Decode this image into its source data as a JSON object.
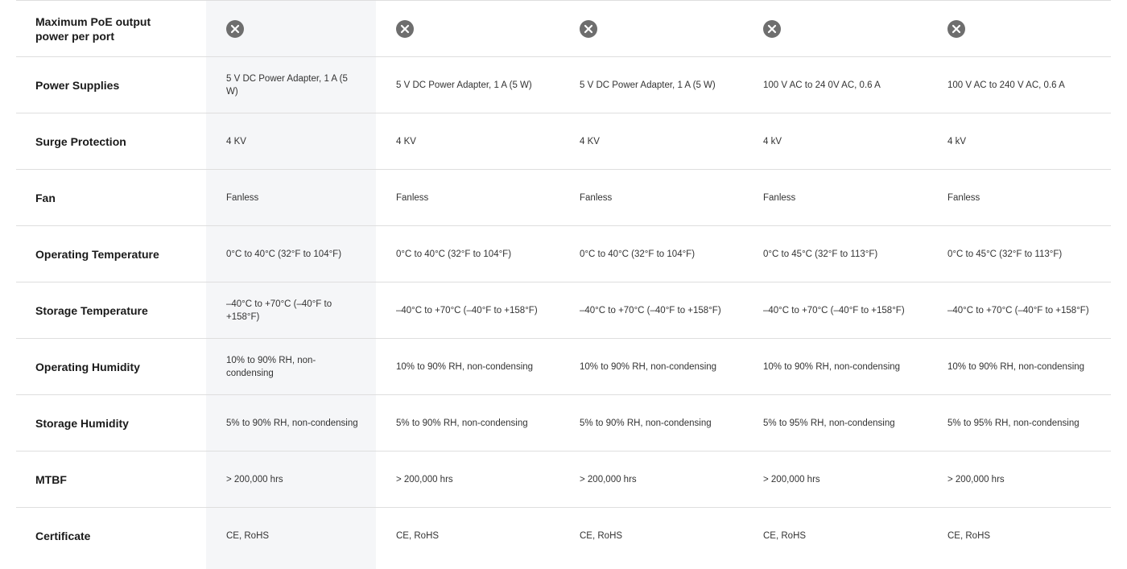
{
  "colors": {
    "highlight_column": "#f5f6f8",
    "row_divider": "#dedede",
    "icon_fill": "#6e6e6e"
  },
  "icons": {
    "not_supported": "x-circle-icon"
  },
  "rows": [
    {
      "label": "Maximum PoE output power per port",
      "cells": [
        "",
        "",
        "",
        "",
        ""
      ]
    },
    {
      "label": "Power Supplies",
      "cells": [
        "5 V DC Power Adapter, 1 A (5 W)",
        "5 V DC Power Adapter, 1 A (5 W)",
        "5 V DC Power Adapter, 1 A (5 W)",
        "100 V AC to 24 0V AC, 0.6 A",
        "100 V AC to 240 V AC, 0.6 A"
      ]
    },
    {
      "label": "Surge Protection",
      "cells": [
        "4 KV",
        "4 KV",
        "4 KV",
        "4 kV",
        "4 kV"
      ]
    },
    {
      "label": "Fan",
      "cells": [
        "Fanless",
        "Fanless",
        "Fanless",
        "Fanless",
        "Fanless"
      ]
    },
    {
      "label": "Operating Temperature",
      "cells": [
        "0°C to 40°C (32°F to 104°F)",
        "0°C to 40°C (32°F to 104°F)",
        "0°C to 40°C (32°F to 104°F)",
        "0°C to 45°C (32°F to 113°F)",
        "0°C to 45°C (32°F to 113°F)"
      ]
    },
    {
      "label": "Storage Temperature",
      "cells": [
        "–40°C to +70°C (–40°F to +158°F)",
        "–40°C to +70°C (–40°F to +158°F)",
        "–40°C to +70°C (–40°F to +158°F)",
        "–40°C to +70°C (–40°F to +158°F)",
        "–40°C to +70°C (–40°F to +158°F)"
      ]
    },
    {
      "label": "Operating Humidity",
      "cells": [
        "10% to 90% RH, non-condensing",
        "10% to 90% RH, non-condensing",
        "10% to 90% RH, non-condensing",
        "10% to 90% RH, non-condensing",
        "10% to 90% RH, non-condensing"
      ]
    },
    {
      "label": "Storage Humidity",
      "cells": [
        "5% to 90% RH, non-condensing",
        "5% to 90% RH, non-condensing",
        "5% to 90% RH, non-condensing",
        "5% to 95% RH, non-condensing",
        "5% to 95% RH, non-condensing"
      ]
    },
    {
      "label": "MTBF",
      "cells": [
        "> 200,000 hrs",
        "> 200,000 hrs",
        "> 200,000 hrs",
        "> 200,000 hrs",
        "> 200,000 hrs"
      ]
    },
    {
      "label": "Certificate",
      "cells": [
        "CE, RoHS",
        "CE, RoHS",
        "CE, RoHS",
        "CE, RoHS",
        "CE, RoHS"
      ]
    }
  ]
}
